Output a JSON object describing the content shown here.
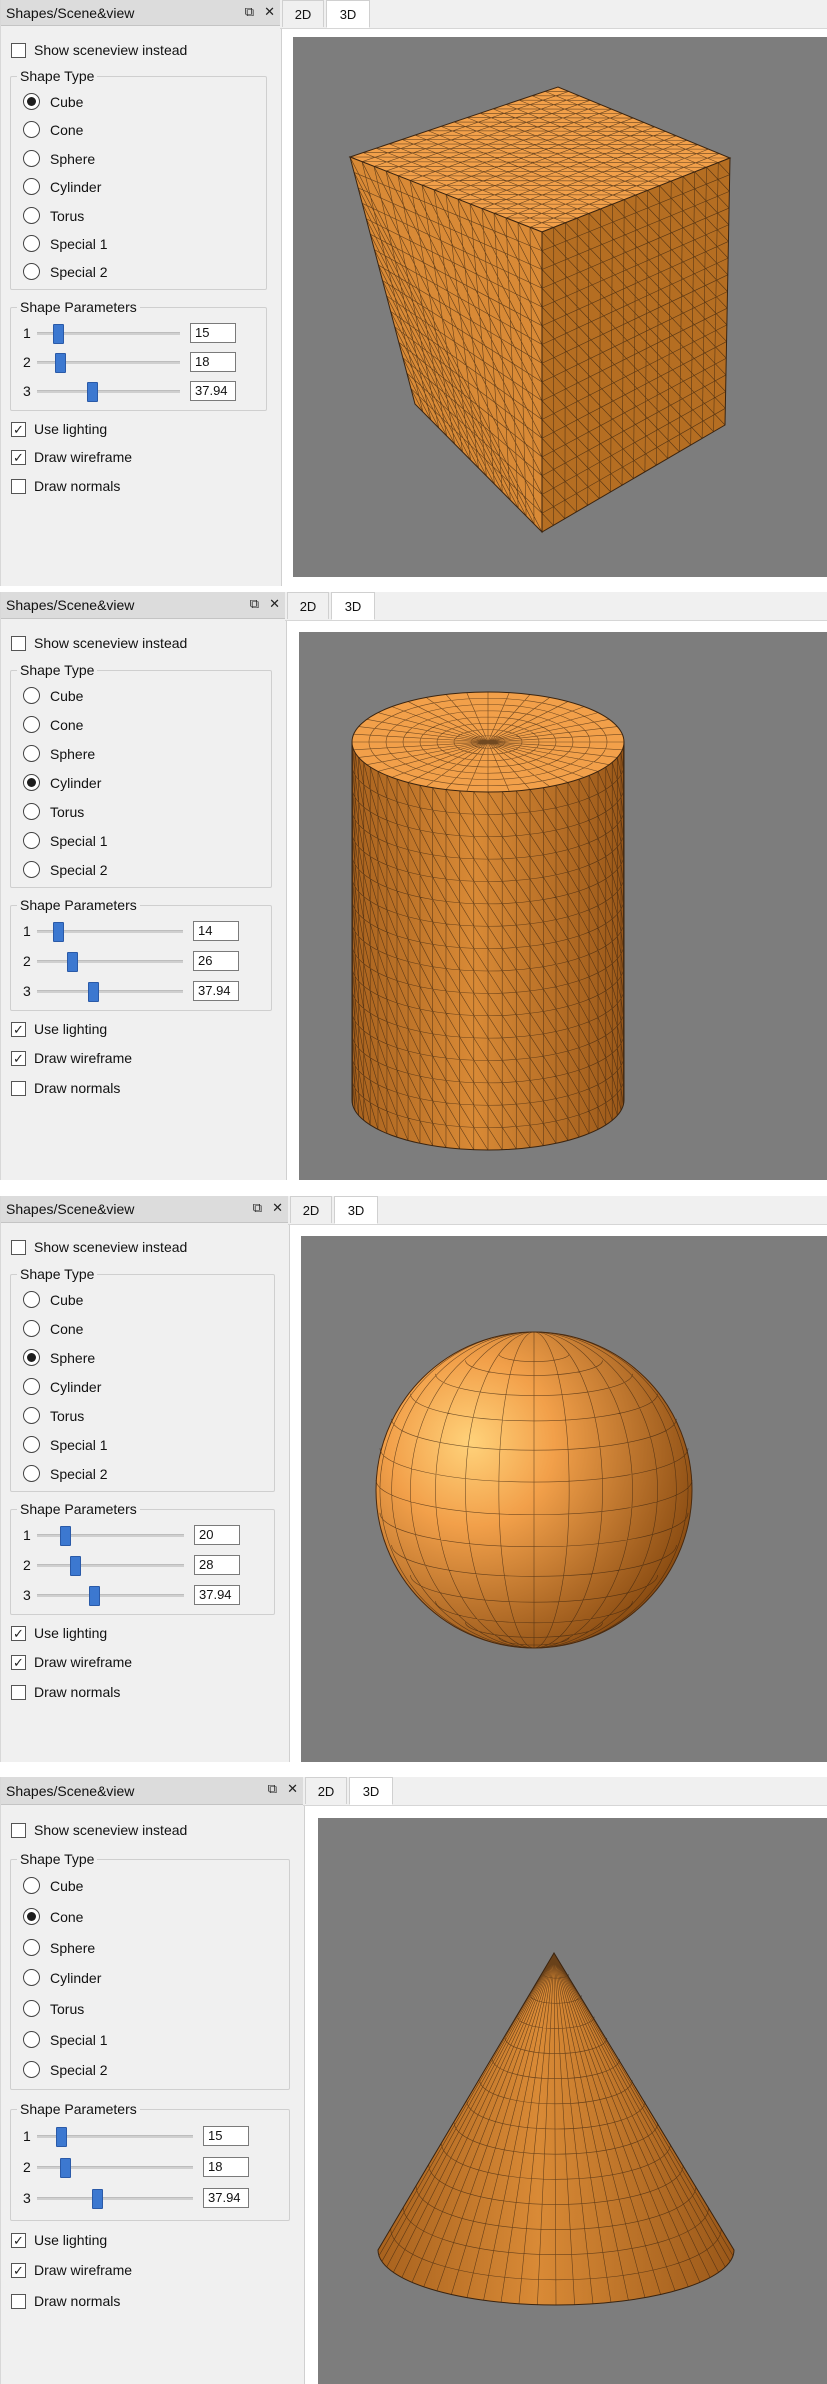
{
  "panels": [
    {
      "dock_title": "Shapes/Scene&view",
      "float_icon": "float-icon",
      "close_icon": "close-icon",
      "show_sceneview": {
        "label": "Show sceneview instead",
        "checked": false
      },
      "shape_type": {
        "title": "Shape Type",
        "options": [
          "Cube",
          "Cone",
          "Sphere",
          "Cylinder",
          "Torus",
          "Special 1",
          "Special 2"
        ],
        "selected": "Cube"
      },
      "shape_parameters": {
        "title": "Shape Parameters",
        "params": [
          {
            "label": "1",
            "value": "15",
            "fraction": 0.12
          },
          {
            "label": "2",
            "value": "18",
            "fraction": 0.14
          },
          {
            "label": "3",
            "value": "37.94",
            "fraction": 0.38
          }
        ]
      },
      "use_lighting": {
        "label": "Use lighting",
        "checked": true
      },
      "draw_wireframe": {
        "label": "Draw wireframe",
        "checked": true
      },
      "draw_normals": {
        "label": "Draw normals",
        "checked": false
      },
      "tabs": [
        "2D",
        "3D"
      ],
      "active_tab": "3D",
      "shape": "cube"
    },
    {
      "dock_title": "Shapes/Scene&view",
      "float_icon": "float-icon",
      "close_icon": "close-icon",
      "show_sceneview": {
        "label": "Show sceneview instead",
        "checked": false
      },
      "shape_type": {
        "title": "Shape Type",
        "options": [
          "Cube",
          "Cone",
          "Sphere",
          "Cylinder",
          "Torus",
          "Special 1",
          "Special 2"
        ],
        "selected": "Cylinder"
      },
      "shape_parameters": {
        "title": "Shape Parameters",
        "params": [
          {
            "label": "1",
            "value": "14",
            "fraction": 0.12
          },
          {
            "label": "2",
            "value": "26",
            "fraction": 0.22
          },
          {
            "label": "3",
            "value": "37.94",
            "fraction": 0.38
          }
        ]
      },
      "use_lighting": {
        "label": "Use lighting",
        "checked": true
      },
      "draw_wireframe": {
        "label": "Draw wireframe",
        "checked": true
      },
      "draw_normals": {
        "label": "Draw normals",
        "checked": false
      },
      "tabs": [
        "2D",
        "3D"
      ],
      "active_tab": "3D",
      "shape": "cylinder"
    },
    {
      "dock_title": "Shapes/Scene&view",
      "float_icon": "float-icon",
      "close_icon": "close-icon",
      "show_sceneview": {
        "label": "Show sceneview instead",
        "checked": false
      },
      "shape_type": {
        "title": "Shape Type",
        "options": [
          "Cube",
          "Cone",
          "Sphere",
          "Cylinder",
          "Torus",
          "Special 1",
          "Special 2"
        ],
        "selected": "Sphere"
      },
      "shape_parameters": {
        "title": "Shape Parameters",
        "params": [
          {
            "label": "1",
            "value": "20",
            "fraction": 0.17
          },
          {
            "label": "2",
            "value": "28",
            "fraction": 0.24
          },
          {
            "label": "3",
            "value": "37.94",
            "fraction": 0.38
          }
        ]
      },
      "use_lighting": {
        "label": "Use lighting",
        "checked": true
      },
      "draw_wireframe": {
        "label": "Draw wireframe",
        "checked": true
      },
      "draw_normals": {
        "label": "Draw normals",
        "checked": false
      },
      "tabs": [
        "2D",
        "3D"
      ],
      "active_tab": "3D",
      "shape": "sphere"
    },
    {
      "dock_title": "Shapes/Scene&view",
      "float_icon": "float-icon",
      "close_icon": "close-icon",
      "show_sceneview": {
        "label": "Show sceneview instead",
        "checked": false
      },
      "shape_type": {
        "title": "Shape Type",
        "options": [
          "Cube",
          "Cone",
          "Sphere",
          "Cylinder",
          "Torus",
          "Special 1",
          "Special 2"
        ],
        "selected": "Cone"
      },
      "shape_parameters": {
        "title": "Shape Parameters",
        "params": [
          {
            "label": "1",
            "value": "15",
            "fraction": 0.13
          },
          {
            "label": "2",
            "value": "18",
            "fraction": 0.16
          },
          {
            "label": "3",
            "value": "37.94",
            "fraction": 0.38
          }
        ]
      },
      "use_lighting": {
        "label": "Use lighting",
        "checked": true
      },
      "draw_wireframe": {
        "label": "Draw wireframe",
        "checked": true
      },
      "draw_normals": {
        "label": "Draw normals",
        "checked": false
      },
      "tabs": [
        "2D",
        "3D"
      ],
      "active_tab": "3D",
      "shape": "cone"
    }
  ],
  "colors": {
    "viewport_bg": "#7d7d7d",
    "shape_light": "#f2a04a",
    "shape_mid": "#d98a36",
    "shape_dark": "#b56e22",
    "wire": "#3a2410",
    "slider_thumb": "#3c78d0"
  }
}
